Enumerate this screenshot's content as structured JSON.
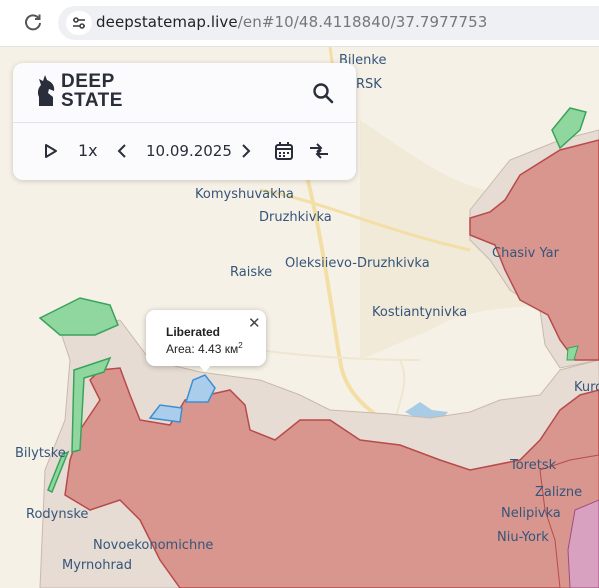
{
  "browser": {
    "url_host": "deepstatemap.live",
    "url_path": "/en#10/48.4118840/37.7977753"
  },
  "panel": {
    "logo_line1": "DEEP",
    "logo_line2": "STATE",
    "speed": "1x",
    "date": "10.09.2025"
  },
  "map": {
    "places": {
      "bilenke": "Bilenke",
      "rsk": "RSK",
      "komyshuvakha": "Komyshuvakha",
      "druzhkivka": "Druzhkivka",
      "chasiv_yar": "Chasiv Yar",
      "raiske": "Raiske",
      "oleksiievo": "Oleksiievo-Druzhkivka",
      "kostiantynivka": "Kostiantynivka",
      "kuro": "Kuro",
      "bilytske": "Bilytske",
      "toretsk": "Toretsk",
      "zalizne": "Zalizne",
      "rodynske": "Rodynske",
      "nelipivka": "Nelipivka",
      "niu_york": "Niu-York",
      "novoekonomichne": "Novoekonomichne",
      "myrnohrad": "Myrnohrad"
    },
    "colors": {
      "background": "#f6f1e6",
      "occupied": "#d9968f",
      "occupied_border": "#b84a4a",
      "contested": "#e6dcd3",
      "liberated": "#a9cdeb",
      "liberated_border": "#3d8fd1",
      "ukraine_regained": "#8fd69f",
      "ukraine_regained_border": "#3aa35a",
      "annexed": "#d8a1bf",
      "road": "#f2dfa8",
      "water": "#a8cce6"
    }
  },
  "popup": {
    "title": "Liberated",
    "area_label": "Area: 4.43 км",
    "area_sup": "2"
  }
}
